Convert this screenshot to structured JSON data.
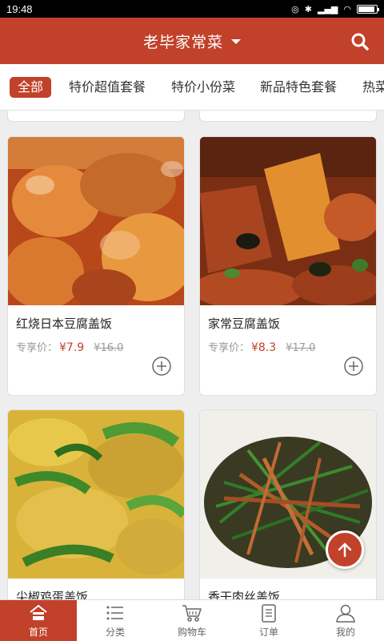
{
  "status_bar": {
    "time": "19:48"
  },
  "header": {
    "title": "老毕家常菜"
  },
  "categories": [
    {
      "label": "全部",
      "active": true
    },
    {
      "label": "特价超值套餐"
    },
    {
      "label": "特价小份菜"
    },
    {
      "label": "新品特色套餐"
    },
    {
      "label": "热菜"
    }
  ],
  "products": [
    {
      "name": "红烧日本豆腐盖饭",
      "price_label": "专享价：",
      "price": "¥7.9",
      "original_price": "¥16.0"
    },
    {
      "name": "家常豆腐盖饭",
      "price_label": "专享价：",
      "price": "¥8.3",
      "original_price": "¥17.0"
    },
    {
      "name": "尖椒鸡蛋盖饭"
    },
    {
      "name": "香干肉丝盖饭"
    }
  ],
  "tabbar": [
    {
      "label": "首页",
      "icon": "home-icon",
      "active": true
    },
    {
      "label": "分类",
      "icon": "list-icon"
    },
    {
      "label": "购物车",
      "icon": "cart-icon"
    },
    {
      "label": "订单",
      "icon": "order-icon"
    },
    {
      "label": "我的",
      "icon": "user-icon"
    }
  ],
  "colors": {
    "accent": "#c1412a",
    "background": "#eeeeee"
  }
}
